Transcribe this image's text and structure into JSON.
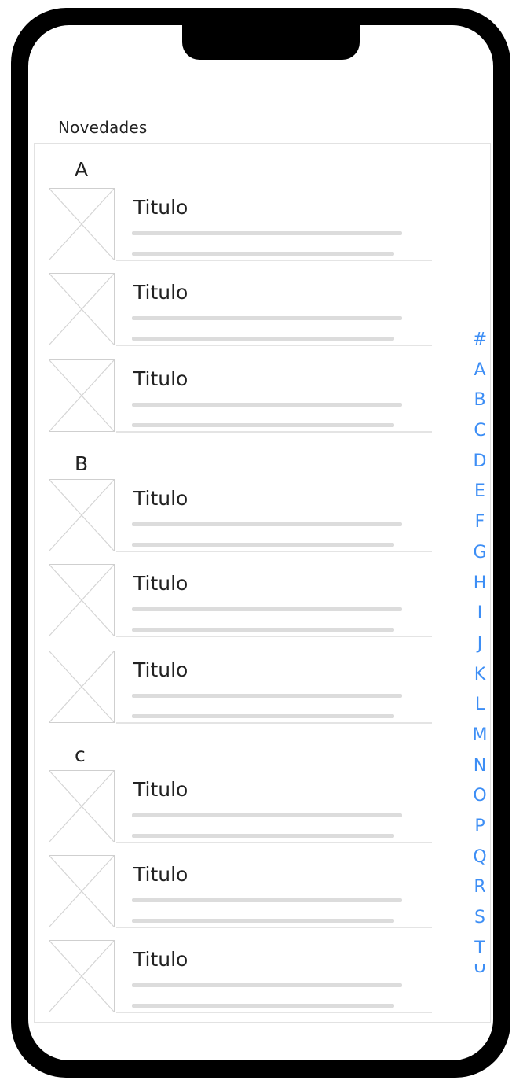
{
  "header": {
    "title": "Novedades"
  },
  "sections": [
    {
      "letter": "A",
      "items": [
        {
          "title": "Titulo"
        },
        {
          "title": "Titulo"
        },
        {
          "title": "Titulo"
        }
      ]
    },
    {
      "letter": "B",
      "items": [
        {
          "title": "Titulo"
        },
        {
          "title": "Titulo"
        },
        {
          "title": "Titulo"
        }
      ]
    },
    {
      "letter": "c",
      "items": [
        {
          "title": "Titulo"
        },
        {
          "title": "Titulo"
        },
        {
          "title": "Titulo"
        }
      ]
    }
  ],
  "alpha_index": [
    "#",
    "A",
    "B",
    "C",
    "D",
    "E",
    "F",
    "G",
    "H",
    "I",
    "J",
    "K",
    "L",
    "M",
    "N",
    "O",
    "P",
    "Q",
    "R",
    "S",
    "T",
    "U"
  ],
  "colors": {
    "accent": "#3d8ef5",
    "frame": "#000000"
  },
  "icons": {
    "thumbnail": "image-placeholder-icon"
  }
}
